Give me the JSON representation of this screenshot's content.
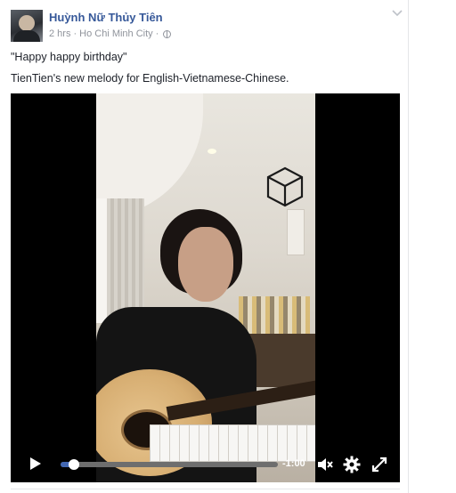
{
  "post": {
    "author": "Huỳnh Nữ Thủy Tiên",
    "time_ago": "2 hrs",
    "separator": "·",
    "location": "Ho Chi Minh City",
    "privacy_icon": "globe-icon",
    "menu_icon": "chevron-down-icon",
    "caption_line1": "\"Happy happy birthday\"",
    "caption_line2": "TienTien's new melody for English-Vietnamese-Chinese."
  },
  "video": {
    "progress_fraction": 0.06,
    "time_remaining": "-1:00",
    "play_icon": "play-icon",
    "mute_icon": "volume-mute-icon",
    "settings_icon": "gear-icon",
    "fullscreen_icon": "expand-icon"
  },
  "colors": {
    "author_link": "#365899",
    "meta_text": "#90949c",
    "progress_accent": "#4267b2"
  }
}
